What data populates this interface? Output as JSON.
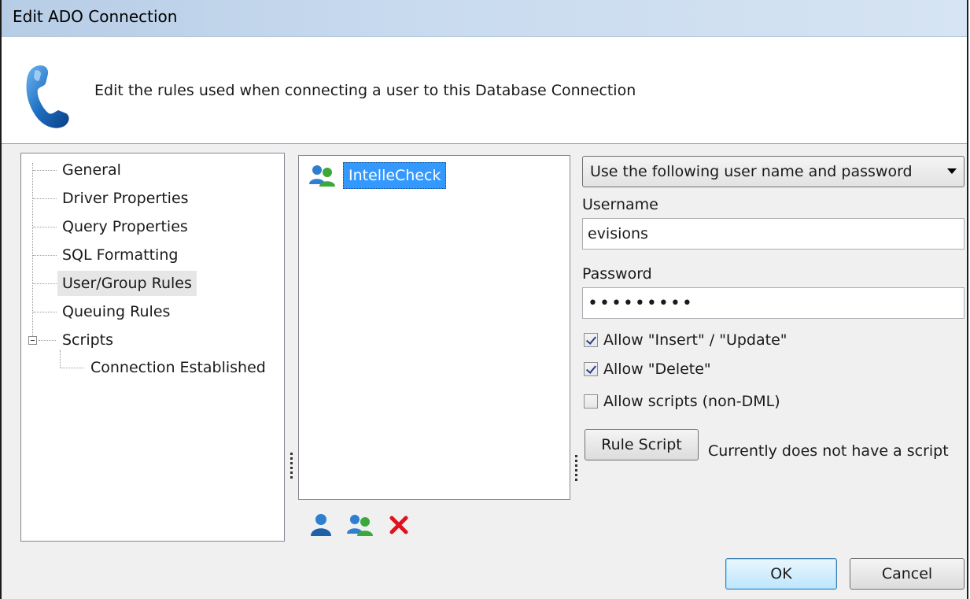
{
  "window": {
    "title": "Edit ADO Connection"
  },
  "header": {
    "icon": "phone-icon",
    "description": "Edit the rules used when connecting a user to this Database Connection"
  },
  "tree": {
    "items": [
      {
        "label": "General"
      },
      {
        "label": "Driver Properties"
      },
      {
        "label": "Query Properties"
      },
      {
        "label": "SQL Formatting"
      },
      {
        "label": "User/Group Rules",
        "selected": true
      },
      {
        "label": "Queuing Rules"
      },
      {
        "label": "Scripts",
        "expanded": true
      },
      {
        "label": "Connection Established"
      }
    ]
  },
  "userlist": {
    "items": [
      {
        "label": "IntelleCheck",
        "icon": "user-group-icon",
        "selected": true
      }
    ],
    "tools": {
      "add_user": "add-user-icon",
      "add_group": "add-group-icon",
      "delete": "delete-icon"
    }
  },
  "rules": {
    "mode_selected": "Use the following user name and password",
    "username_label": "Username",
    "username_value": "evisions",
    "password_label": "Password",
    "password_value": "•••••••••",
    "allow_insert_update": {
      "label": "Allow \"Insert\" / \"Update\"",
      "checked": true
    },
    "allow_delete": {
      "label": "Allow \"Delete\"",
      "checked": true
    },
    "allow_scripts": {
      "label": "Allow scripts (non-DML)",
      "checked": false
    },
    "rule_script_label": "Rule Script",
    "rule_script_status": "Currently does not have a script"
  },
  "footer": {
    "ok_label": "OK",
    "cancel_label": "Cancel"
  },
  "colors": {
    "selection": "#3399ff",
    "titlebar": "#c9dbef",
    "delete_red": "#e0121b"
  }
}
